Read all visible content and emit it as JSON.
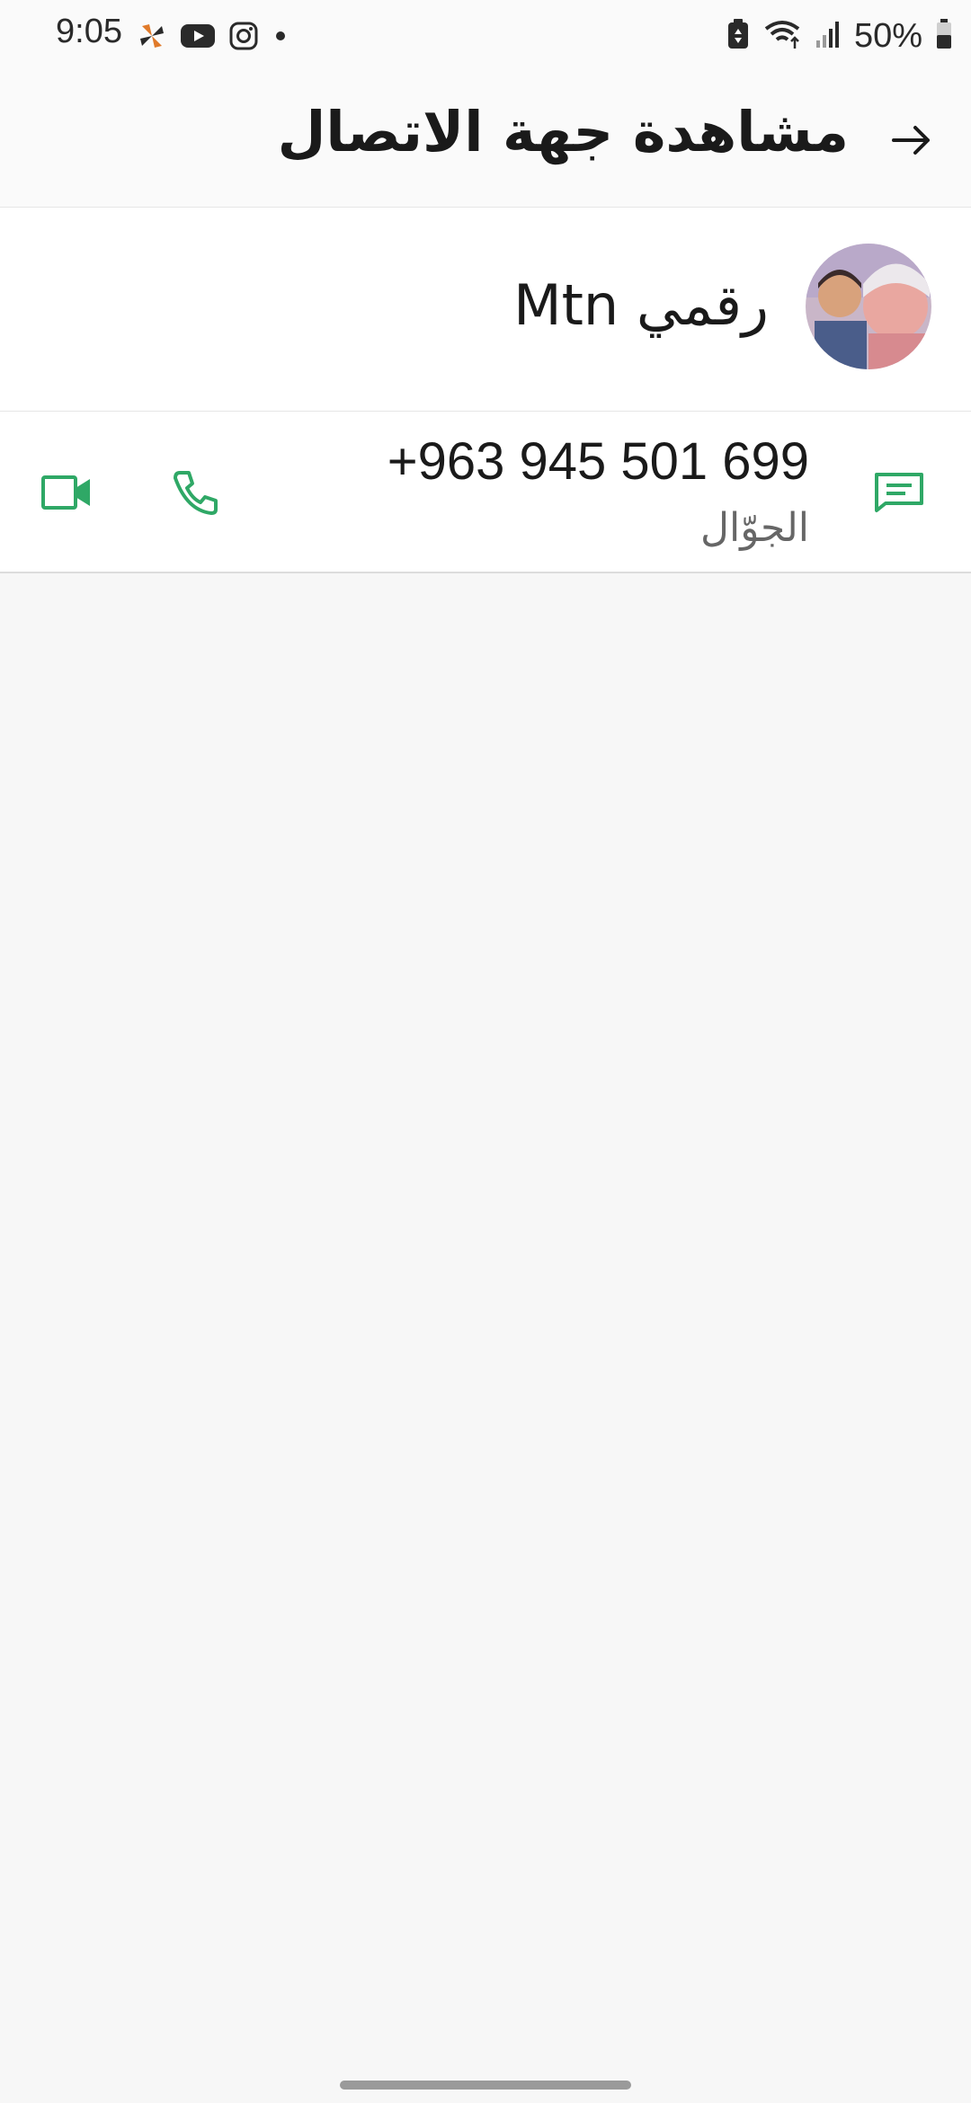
{
  "status_bar": {
    "time": "9:05",
    "battery": "50%",
    "icons_left": [
      "pinwheel-icon",
      "youtube-icon",
      "instagram-icon",
      "dot-icon"
    ],
    "icons_right": [
      "battery-saver-icon",
      "wifi-icon",
      "signal-icon",
      "battery-icon"
    ]
  },
  "app_bar": {
    "title": "مشاهدة جهة الاتصال",
    "back_icon": "arrow-right-icon"
  },
  "contact": {
    "name": "رقمي Mtn",
    "avatar_icon": "avatar-photo"
  },
  "phone": {
    "number": "+963 945 501 699",
    "type": "الجوّال",
    "actions": [
      "message-icon",
      "call-icon",
      "video-call-icon"
    ]
  },
  "colors": {
    "accent": "#2fa866",
    "background": "#f7f7f7",
    "card": "#ffffff"
  }
}
